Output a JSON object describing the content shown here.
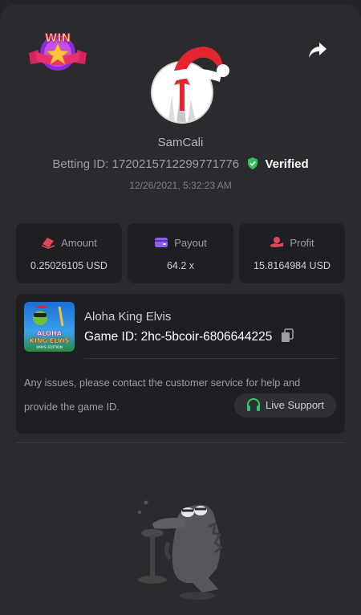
{
  "badge": {
    "text": "WIN"
  },
  "user": {
    "name": "SamCali",
    "betting_id_label": "Betting ID:",
    "betting_id": "1720215712299771776",
    "verified_label": "Verified",
    "timestamp": "12/26/2021, 5:32:23 AM"
  },
  "stats": [
    {
      "label": "Amount",
      "value": "0.25026105 USD",
      "icon": "coins-icon",
      "icon_color": "#e0475d"
    },
    {
      "label": "Payout",
      "value": "64.2 x",
      "icon": "wallet-icon",
      "icon_color": "#8f5cf5"
    },
    {
      "label": "Profit",
      "value": "15.8164984 USD",
      "icon": "money-hand-icon",
      "icon_color": "#e0475d"
    }
  ],
  "game": {
    "name": "Aloha King Elvis",
    "id_label": "Game ID:",
    "id": "2hc-5bcoir-6806644225",
    "thumb_title_1": "ALOHA",
    "thumb_title_2": "KING ELVIS",
    "thumb_subtitle": "XMAS EDITION"
  },
  "support": {
    "message": "Any issues, please contact the customer service for help and provide the game ID.",
    "button_label": "Live Support",
    "icon_color": "#35c46a"
  },
  "colors": {
    "background": "#2a2b2f",
    "card": "#1e1f23",
    "verified_green": "#2ec05c",
    "accent_red": "#e0475d"
  }
}
